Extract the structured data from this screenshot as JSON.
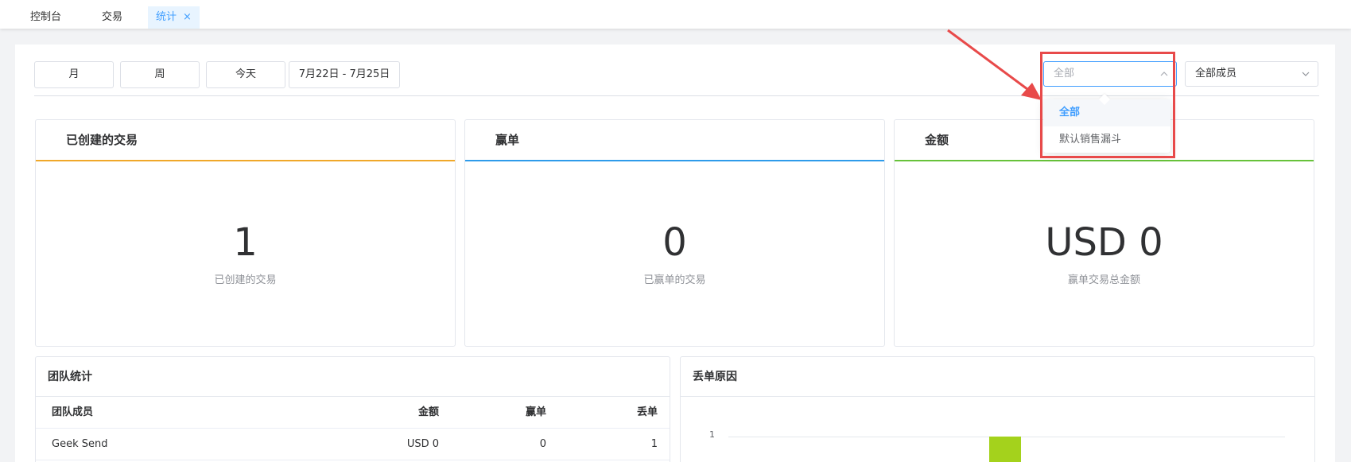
{
  "tabs": [
    {
      "label": "控制台"
    },
    {
      "label": "交易"
    },
    {
      "label": "统计",
      "close": "×"
    }
  ],
  "toolbar": {
    "month_label": "月",
    "week_label": "周",
    "today_label": "今天",
    "date_range": "7月22日 - 7月25日"
  },
  "pipeline_select": {
    "value": "全部",
    "options": [
      "全部",
      "默认销售漏斗"
    ],
    "selected_index": 0
  },
  "member_select": {
    "value": "全部成员"
  },
  "cards": [
    {
      "title": "已创建的交易",
      "value": "1",
      "caption": "已创建的交易",
      "accent": "#f0a82a"
    },
    {
      "title": "赢单",
      "value": "0",
      "caption": "已赢单的交易",
      "accent": "#2e9bea"
    },
    {
      "title": "金额",
      "value": "USD 0",
      "caption": "赢单交易总金额",
      "accent": "#67c23a"
    }
  ],
  "team_stats": {
    "title": "团队统计",
    "columns": [
      "团队成员",
      "金额",
      "赢单",
      "丢单"
    ],
    "rows": [
      {
        "member": "Geek Send",
        "amount": "USD 0",
        "won": "0",
        "lost": "1"
      }
    ]
  },
  "loss_reasons": {
    "title": "丢单原因"
  },
  "chart_data": {
    "type": "bar",
    "title": "丢单原因",
    "y_ticks": [
      "1"
    ],
    "values": [
      1
    ],
    "color": "#a4d21c"
  },
  "annotation_color": "#e84a4a"
}
